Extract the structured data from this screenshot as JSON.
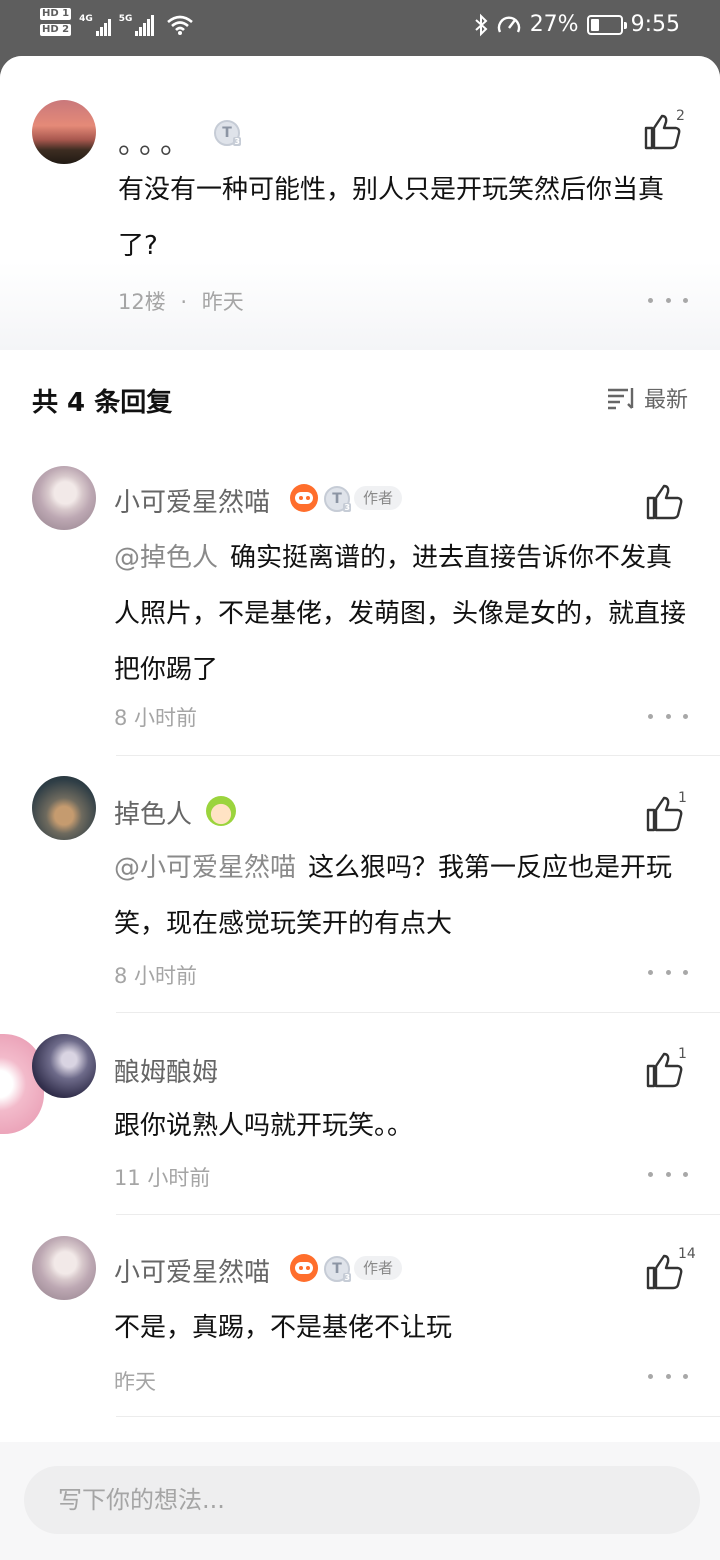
{
  "status_bar": {
    "hd1": "HD 1",
    "hd2": "HD 2",
    "net1": "4G",
    "net2": "5G",
    "battery": "27%",
    "battery_level": 0.27,
    "time": "9:55"
  },
  "original_post": {
    "username": "。。。",
    "text": "有没有一种可能性，别人只是开玩笑然后你当真了?",
    "floor": "12楼",
    "separator": "·",
    "time": "昨天",
    "likes": "2"
  },
  "replies_header": {
    "title": "共 4 条回复",
    "sort_label": "最新"
  },
  "replies": [
    {
      "username": "小可爱星然喵",
      "author_tag": "作者",
      "mention": "@掉色人",
      "text": "确实挺离谱的，进去直接告诉你不发真人照片，不是基佬，发萌图，头像是女的，就直接把你踢了",
      "time": "8 小时前",
      "likes": ""
    },
    {
      "username": "掉色人",
      "mention": "@小可爱星然喵",
      "text": "这么狠吗？我第一反应也是开玩笑，现在感觉玩笑开的有点大",
      "time": "8 小时前",
      "likes": "1"
    },
    {
      "username": "酿姆酿姆",
      "text": "跟你说熟人吗就开玩笑。。",
      "time": "11 小时前",
      "likes": "1"
    },
    {
      "username": "小可爱星然喵",
      "author_tag": "作者",
      "text": "不是，真踢，不是基佬不让玩",
      "time": "昨天",
      "likes": "14"
    }
  ],
  "badges": {
    "level_glyph": "T",
    "level_sub": "3"
  },
  "composer": {
    "placeholder": "写下你的想法..."
  },
  "colors": {
    "accent_orange": "#ff6e2c",
    "status_bar": "#5e5e5e"
  }
}
